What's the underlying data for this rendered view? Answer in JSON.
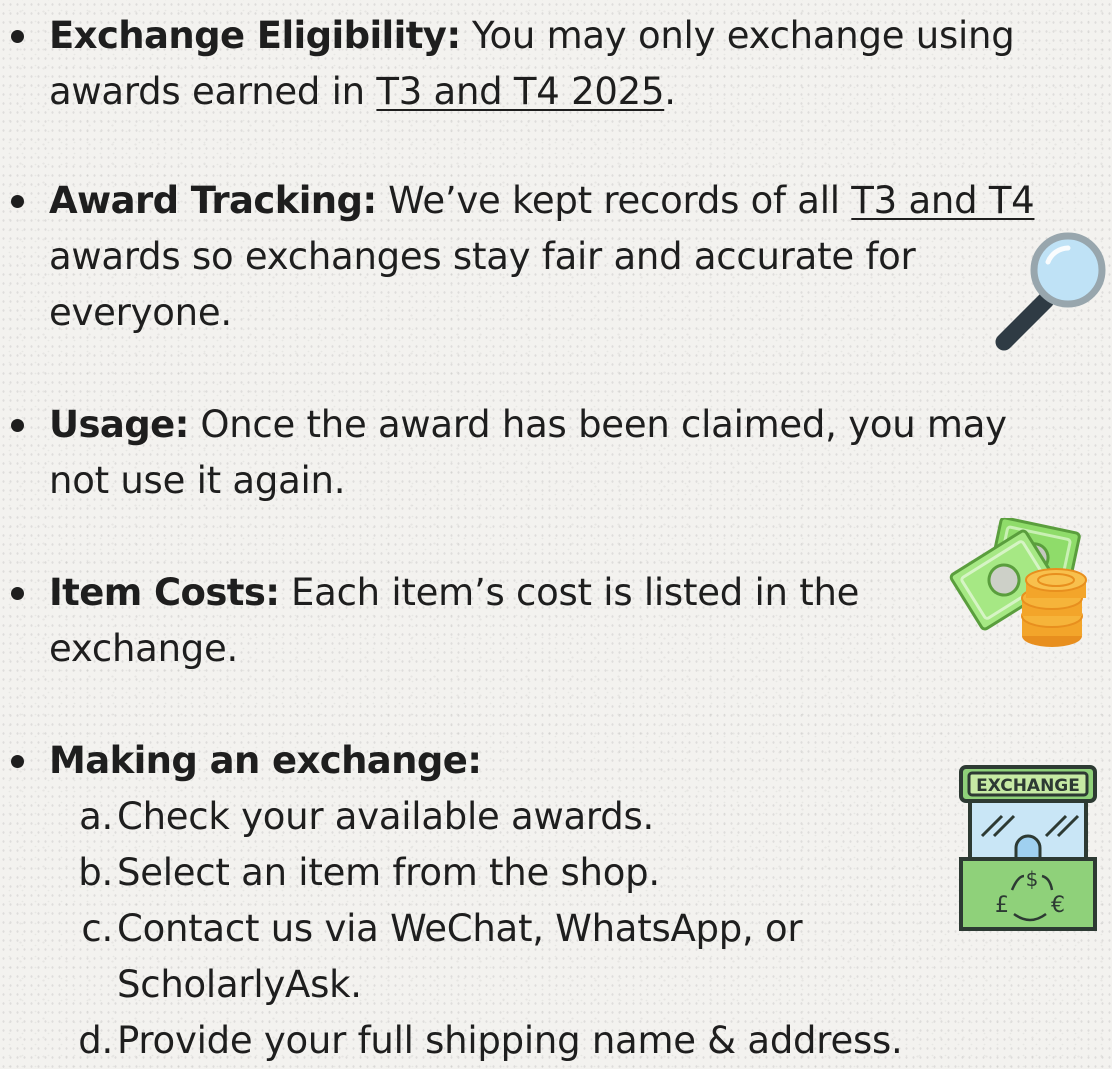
{
  "items": [
    {
      "title": "Exchange Eligibility:",
      "line1_text": " You may only exchange using",
      "line2_prefix": "awards earned in ",
      "line2_link": "T3 and T4 2025",
      "line2_suffix": "."
    },
    {
      "title": "Award Tracking:",
      "line1_text": " We’ve kept records of all ",
      "line1_link": "T3 and T4",
      "line2": "awards so exchanges stay fair and accurate for",
      "line3": "everyone."
    },
    {
      "title": "Usage:",
      "line1_text": " Once the award has been claimed, you may",
      "line2": "not use it again."
    },
    {
      "title": "Item Costs:",
      "line1_text": " Each item’s cost is listed in the",
      "line2": "exchange."
    },
    {
      "title": "Making an exchange:",
      "steps": [
        {
          "marker": "a.",
          "text": "Check your available awards."
        },
        {
          "marker": "b.",
          "text": "Select an item from the shop."
        },
        {
          "marker": "c.",
          "text": "Contact us via WeChat, WhatsApp, or",
          "text2": "ScholarlyAsk."
        },
        {
          "marker": "d.",
          "text": "Provide your full shipping name & address."
        }
      ]
    }
  ],
  "icons": {
    "magnifier": "magnifying-glass-icon",
    "money": "money-coins-icon",
    "exchange": "exchange-booth-icon"
  },
  "exchange_sign": "EXCHANGE",
  "currency_symbols": {
    "dollar": "$",
    "pound": "£",
    "euro": "€"
  }
}
